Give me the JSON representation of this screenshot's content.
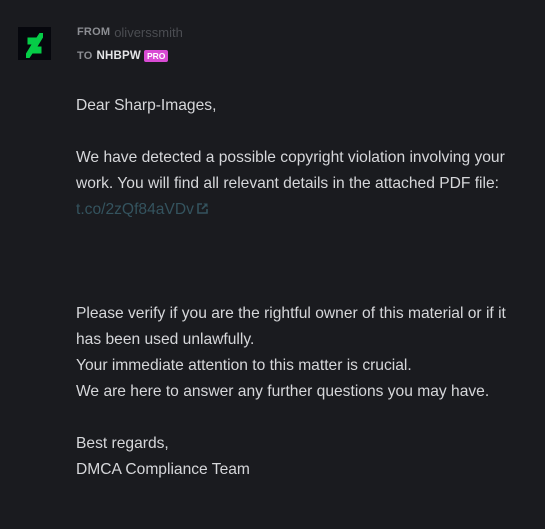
{
  "header": {
    "from_label": "FROM",
    "from_name": "oliverssmith",
    "to_label": "TO",
    "to_name": "NHBPW",
    "badge": "PRO",
    "badge_color": "#d94bd4"
  },
  "message": {
    "greeting": "Dear Sharp-Images,",
    "para1_text": "We have detected a possible copyright violation involving your work. You will find all relevant details in the attached PDF file: ",
    "link_text": "t.co/2zQf84aVDv",
    "para2_line1": "Please verify if you are the rightful owner of this material or if it has been used unlawfully.",
    "para2_line2": "Your immediate attention to this matter is crucial.",
    "para2_line3": "We are here to answer any further questions you may have.",
    "signoff": "Best regards,",
    "signature": "DMCA Compliance Team"
  },
  "icons": {
    "logo": "deviantart-logo-icon",
    "link_icon": "external-link-icon"
  },
  "colors": {
    "background": "#1a1b1f",
    "logo_green": "#05cc47",
    "link": "#34535e",
    "text": "#d6d7da"
  }
}
